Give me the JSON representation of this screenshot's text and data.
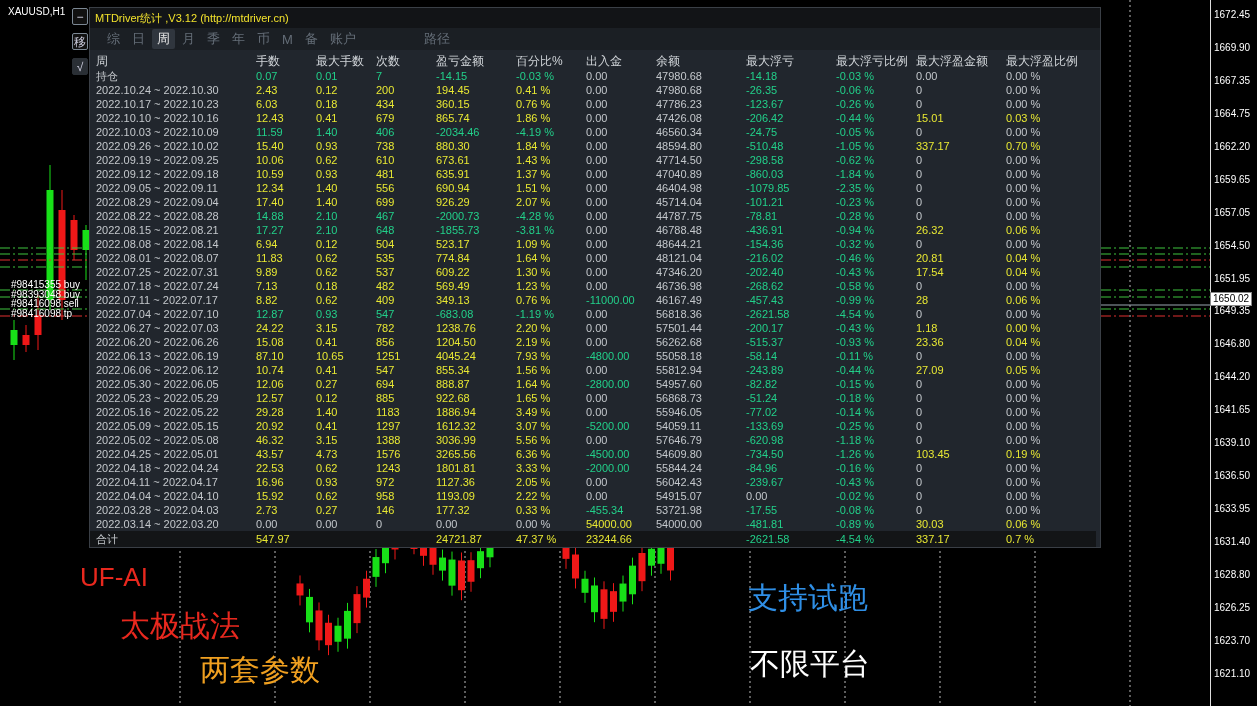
{
  "chart": {
    "symbol": "XAUUSD,H1",
    "side_buttons": [
      "−",
      "移",
      "√"
    ],
    "order_labels": [
      "#98415355 buy",
      "#98393048 buy",
      "#98416098 sell",
      "#98416098 tp"
    ],
    "price_labels": [
      "1672.45",
      "1669.90",
      "1667.35",
      "1664.75",
      "1662.20",
      "1659.65",
      "1657.05",
      "1654.50",
      "1651.95",
      "1649.35",
      "1646.80",
      "1644.20",
      "1641.65",
      "1639.10",
      "1636.50",
      "1633.95",
      "1631.40",
      "1628.80",
      "1626.25",
      "1623.70",
      "1621.10"
    ],
    "current_price": "1650.02",
    "promo_texts": [
      {
        "text": "UF-AI",
        "color": "#e8281e"
      },
      {
        "text": "太极战法",
        "color": "#e8281e"
      },
      {
        "text": "两套参数",
        "color": "#f0a020"
      },
      {
        "text": "支持试跑",
        "color": "#2f8fe6"
      },
      {
        "text": "不限平台",
        "color": "#ffffff"
      }
    ]
  },
  "panel": {
    "title": "MTDriver统计 ,V3.12 (http://mtdriver.cn)",
    "tabs": [
      {
        "label": "综",
        "selected": false
      },
      {
        "label": "日",
        "selected": false
      },
      {
        "label": "周",
        "selected": true
      },
      {
        "label": "月",
        "selected": false
      },
      {
        "label": "季",
        "selected": false
      },
      {
        "label": "年",
        "selected": false
      },
      {
        "label": "币",
        "selected": false
      },
      {
        "label": "M",
        "selected": false
      },
      {
        "label": "备",
        "selected": false
      },
      {
        "label": "账户",
        "selected": false
      },
      {
        "label": "路径",
        "selected": false
      }
    ],
    "period_column": "周",
    "columns": [
      "手数",
      "最大手数",
      "次数",
      "盈亏金额",
      "百分比%",
      "出入金",
      "余额",
      "最大浮亏",
      "最大浮亏比例",
      "最大浮盈金额",
      "最大浮盈比例"
    ],
    "rows": [
      {
        "period": "持仓",
        "cells": [
          "0.07",
          "0.01",
          "7",
          "-14.15",
          "-0.03 %",
          "0.00",
          "47980.68",
          "-14.18",
          "-0.03 %",
          "0.00",
          "0.00 %"
        ]
      },
      {
        "period": "2022.10.24 ~ 2022.10.30",
        "cells": [
          "2.43",
          "0.12",
          "200",
          "194.45",
          "0.41 %",
          "0.00",
          "47980.68",
          "-26.35",
          "-0.06 %",
          "0",
          "0.00 %"
        ]
      },
      {
        "period": "2022.10.17 ~ 2022.10.23",
        "cells": [
          "6.03",
          "0.18",
          "434",
          "360.15",
          "0.76 %",
          "0.00",
          "47786.23",
          "-123.67",
          "-0.26 %",
          "0",
          "0.00 %"
        ]
      },
      {
        "period": "2022.10.10 ~ 2022.10.16",
        "cells": [
          "12.43",
          "0.41",
          "679",
          "865.74",
          "1.86 %",
          "0.00",
          "47426.08",
          "-206.42",
          "-0.44 %",
          "15.01",
          "0.03 %"
        ]
      },
      {
        "period": "2022.10.03 ~ 2022.10.09",
        "cells": [
          "11.59",
          "1.40",
          "406",
          "-2034.46",
          "-4.19 %",
          "0.00",
          "46560.34",
          "-24.75",
          "-0.05 %",
          "0",
          "0.00 %"
        ]
      },
      {
        "period": "2022.09.26 ~ 2022.10.02",
        "cells": [
          "15.40",
          "0.93",
          "738",
          "880.30",
          "1.84 %",
          "0.00",
          "48594.80",
          "-510.48",
          "-1.05 %",
          "337.17",
          "0.70 %"
        ]
      },
      {
        "period": "2022.09.19 ~ 2022.09.25",
        "cells": [
          "10.06",
          "0.62",
          "610",
          "673.61",
          "1.43 %",
          "0.00",
          "47714.50",
          "-298.58",
          "-0.62 %",
          "0",
          "0.00 %"
        ]
      },
      {
        "period": "2022.09.12 ~ 2022.09.18",
        "cells": [
          "10.59",
          "0.93",
          "481",
          "635.91",
          "1.37 %",
          "0.00",
          "47040.89",
          "-860.03",
          "-1.84 %",
          "0",
          "0.00 %"
        ]
      },
      {
        "period": "2022.09.05 ~ 2022.09.11",
        "cells": [
          "12.34",
          "1.40",
          "556",
          "690.94",
          "1.51 %",
          "0.00",
          "46404.98",
          "-1079.85",
          "-2.35 %",
          "0",
          "0.00 %"
        ]
      },
      {
        "period": "2022.08.29 ~ 2022.09.04",
        "cells": [
          "17.40",
          "1.40",
          "699",
          "926.29",
          "2.07 %",
          "0.00",
          "45714.04",
          "-101.21",
          "-0.23 %",
          "0",
          "0.00 %"
        ]
      },
      {
        "period": "2022.08.22 ~ 2022.08.28",
        "cells": [
          "14.88",
          "2.10",
          "467",
          "-2000.73",
          "-4.28 %",
          "0.00",
          "44787.75",
          "-78.81",
          "-0.28 %",
          "0",
          "0.00 %"
        ]
      },
      {
        "period": "2022.08.15 ~ 2022.08.21",
        "cells": [
          "17.27",
          "2.10",
          "648",
          "-1855.73",
          "-3.81 %",
          "0.00",
          "46788.48",
          "-436.91",
          "-0.94 %",
          "26.32",
          "0.06 %"
        ]
      },
      {
        "period": "2022.08.08 ~ 2022.08.14",
        "cells": [
          "6.94",
          "0.12",
          "504",
          "523.17",
          "1.09 %",
          "0.00",
          "48644.21",
          "-154.36",
          "-0.32 %",
          "0",
          "0.00 %"
        ]
      },
      {
        "period": "2022.08.01 ~ 2022.08.07",
        "cells": [
          "11.83",
          "0.62",
          "535",
          "774.84",
          "1.64 %",
          "0.00",
          "48121.04",
          "-216.02",
          "-0.46 %",
          "20.81",
          "0.04 %"
        ]
      },
      {
        "period": "2022.07.25 ~ 2022.07.31",
        "cells": [
          "9.89",
          "0.62",
          "537",
          "609.22",
          "1.30 %",
          "0.00",
          "47346.20",
          "-202.40",
          "-0.43 %",
          "17.54",
          "0.04 %"
        ]
      },
      {
        "period": "2022.07.18 ~ 2022.07.24",
        "cells": [
          "7.13",
          "0.18",
          "482",
          "569.49",
          "1.23 %",
          "0.00",
          "46736.98",
          "-268.62",
          "-0.58 %",
          "0",
          "0.00 %"
        ]
      },
      {
        "period": "2022.07.11 ~ 2022.07.17",
        "cells": [
          "8.82",
          "0.62",
          "409",
          "349.13",
          "0.76 %",
          "-11000.00",
          "46167.49",
          "-457.43",
          "-0.99 %",
          "28",
          "0.06 %"
        ]
      },
      {
        "period": "2022.07.04 ~ 2022.07.10",
        "cells": [
          "12.87",
          "0.93",
          "547",
          "-683.08",
          "-1.19 %",
          "0.00",
          "56818.36",
          "-2621.58",
          "-4.54 %",
          "0",
          "0.00 %"
        ]
      },
      {
        "period": "2022.06.27 ~ 2022.07.03",
        "cells": [
          "24.22",
          "3.15",
          "782",
          "1238.76",
          "2.20 %",
          "0.00",
          "57501.44",
          "-200.17",
          "-0.43 %",
          "1.18",
          "0.00 %"
        ]
      },
      {
        "period": "2022.06.20 ~ 2022.06.26",
        "cells": [
          "15.08",
          "0.41",
          "856",
          "1204.50",
          "2.19 %",
          "0.00",
          "56262.68",
          "-515.37",
          "-0.93 %",
          "23.36",
          "0.04 %"
        ]
      },
      {
        "period": "2022.06.13 ~ 2022.06.19",
        "cells": [
          "87.10",
          "10.65",
          "1251",
          "4045.24",
          "7.93 %",
          "-4800.00",
          "55058.18",
          "-58.14",
          "-0.11 %",
          "0",
          "0.00 %"
        ]
      },
      {
        "period": "2022.06.06 ~ 2022.06.12",
        "cells": [
          "10.74",
          "0.41",
          "547",
          "855.34",
          "1.56 %",
          "0.00",
          "55812.94",
          "-243.89",
          "-0.44 %",
          "27.09",
          "0.05 %"
        ]
      },
      {
        "period": "2022.05.30 ~ 2022.06.05",
        "cells": [
          "12.06",
          "0.27",
          "694",
          "888.87",
          "1.64 %",
          "-2800.00",
          "54957.60",
          "-82.82",
          "-0.15 %",
          "0",
          "0.00 %"
        ]
      },
      {
        "period": "2022.05.23 ~ 2022.05.29",
        "cells": [
          "12.57",
          "0.12",
          "885",
          "922.68",
          "1.65 %",
          "0.00",
          "56868.73",
          "-51.24",
          "-0.18 %",
          "0",
          "0.00 %"
        ]
      },
      {
        "period": "2022.05.16 ~ 2022.05.22",
        "cells": [
          "29.28",
          "1.40",
          "1183",
          "1886.94",
          "3.49 %",
          "0.00",
          "55946.05",
          "-77.02",
          "-0.14 %",
          "0",
          "0.00 %"
        ]
      },
      {
        "period": "2022.05.09 ~ 2022.05.15",
        "cells": [
          "20.92",
          "0.41",
          "1297",
          "1612.32",
          "3.07 %",
          "-5200.00",
          "54059.11",
          "-133.69",
          "-0.25 %",
          "0",
          "0.00 %"
        ]
      },
      {
        "period": "2022.05.02 ~ 2022.05.08",
        "cells": [
          "46.32",
          "3.15",
          "1388",
          "3036.99",
          "5.56 %",
          "0.00",
          "57646.79",
          "-620.98",
          "-1.18 %",
          "0",
          "0.00 %"
        ]
      },
      {
        "period": "2022.04.25 ~ 2022.05.01",
        "cells": [
          "43.57",
          "4.73",
          "1576",
          "3265.56",
          "6.36 %",
          "-4500.00",
          "54609.80",
          "-734.50",
          "-1.26 %",
          "103.45",
          "0.19 %"
        ]
      },
      {
        "period": "2022.04.18 ~ 2022.04.24",
        "cells": [
          "22.53",
          "0.62",
          "1243",
          "1801.81",
          "3.33 %",
          "-2000.00",
          "55844.24",
          "-84.96",
          "-0.16 %",
          "0",
          "0.00 %"
        ]
      },
      {
        "period": "2022.04.11 ~ 2022.04.17",
        "cells": [
          "16.96",
          "0.93",
          "972",
          "1127.36",
          "2.05 %",
          "0.00",
          "56042.43",
          "-239.67",
          "-0.43 %",
          "0",
          "0.00 %"
        ]
      },
      {
        "period": "2022.04.04 ~ 2022.04.10",
        "cells": [
          "15.92",
          "0.62",
          "958",
          "1193.09",
          "2.22 %",
          "0.00",
          "54915.07",
          "0.00",
          "-0.02 %",
          "0",
          "0.00 %"
        ]
      },
      {
        "period": "2022.03.28 ~ 2022.04.03",
        "cells": [
          "2.73",
          "0.27",
          "146",
          "177.32",
          "0.33 %",
          "-455.34",
          "53721.98",
          "-17.55",
          "-0.08 %",
          "0",
          "0.00 %"
        ]
      },
      {
        "period": "2022.03.14 ~ 2022.03.20",
        "cells": [
          "0.00",
          "0.00",
          "0",
          "0.00",
          "0.00 %",
          "54000.00",
          "54000.00",
          "-481.81",
          "-0.89 %",
          "30.03",
          "0.06 %"
        ]
      }
    ],
    "total": {
      "period": "合计",
      "cells": [
        "547.97",
        null,
        null,
        "24721.87",
        "47.37 %",
        "23244.66",
        null,
        "-2621.58",
        "-4.54 %",
        "337.17",
        "0.7 %"
      ]
    }
  }
}
